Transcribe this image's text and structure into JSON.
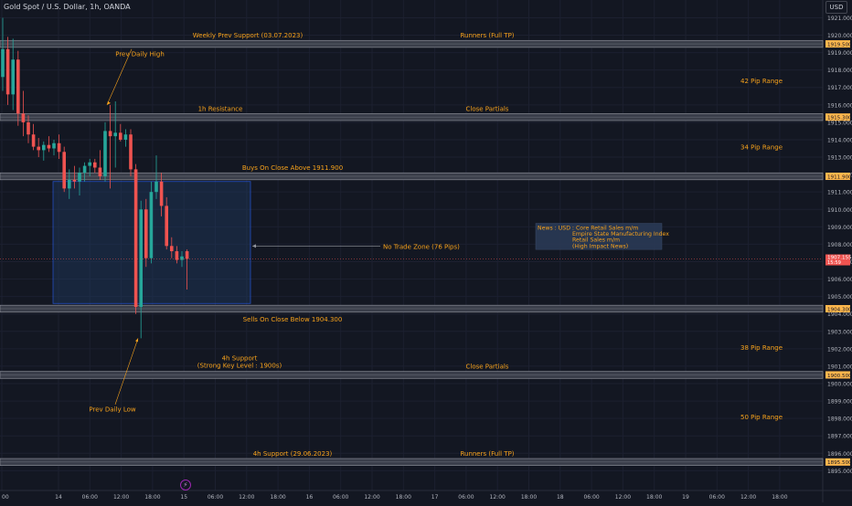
{
  "header": {
    "title": "Gold Spot / U.S. Dollar, 1h, OANDA",
    "currency": "USD"
  },
  "colors": {
    "background": "#131722",
    "bull": "#26a69a",
    "bear": "#ef5350",
    "label": "#f7a21b",
    "band": "#3a3e4a",
    "zone_fill": "#1e3a5f",
    "zone_border": "#2962ff",
    "grid": "#1c2030",
    "axis_text": "#b2b5be",
    "price_tag": "#ef5350"
  },
  "chart_data": {
    "type": "candlestick",
    "y_range": [
      1894.6,
      1921.6
    ],
    "y_ticks": [
      "1921.000",
      "1920.000",
      "1919.000",
      "1918.000",
      "1917.000",
      "1916.000",
      "1915.000",
      "1914.000",
      "1913.000",
      "1912.000",
      "1911.000",
      "1910.000",
      "1909.000",
      "1908.000",
      "1907.000",
      "1906.000",
      "1905.000",
      "1904.000",
      "1903.000",
      "1902.000",
      "1901.000",
      "1900.000",
      "1899.000",
      "1898.000",
      "1897.000",
      "1896.000",
      "1895.000"
    ],
    "x_ticks": [
      "00",
      "14",
      "06:00",
      "12:00",
      "18:00",
      "15",
      "06:00",
      "12:00",
      "18:00",
      "16",
      "06:00",
      "12:00",
      "18:00",
      "17",
      "06:00",
      "12:00",
      "18:00",
      "18",
      "06:00",
      "12:00",
      "18:00",
      "19",
      "06:00",
      "12:00",
      "18:00"
    ],
    "candles": [
      {
        "o": 1917.6,
        "h": 1921.0,
        "l": 1916.8,
        "c": 1919.2
      },
      {
        "o": 1919.2,
        "h": 1919.9,
        "l": 1916.0,
        "c": 1916.6
      },
      {
        "o": 1916.6,
        "h": 1919.8,
        "l": 1915.7,
        "c": 1918.6
      },
      {
        "o": 1918.6,
        "h": 1919.1,
        "l": 1914.8,
        "c": 1915.5
      },
      {
        "o": 1915.5,
        "h": 1916.8,
        "l": 1914.2,
        "c": 1915.0
      },
      {
        "o": 1915.0,
        "h": 1915.4,
        "l": 1913.8,
        "c": 1914.3
      },
      {
        "o": 1914.3,
        "h": 1914.9,
        "l": 1913.4,
        "c": 1913.6
      },
      {
        "o": 1913.6,
        "h": 1914.1,
        "l": 1913.0,
        "c": 1913.4
      },
      {
        "o": 1913.4,
        "h": 1913.9,
        "l": 1912.8,
        "c": 1913.7
      },
      {
        "o": 1913.7,
        "h": 1914.2,
        "l": 1913.3,
        "c": 1913.5
      },
      {
        "o": 1913.5,
        "h": 1914.0,
        "l": 1913.1,
        "c": 1913.8
      },
      {
        "o": 1913.8,
        "h": 1914.3,
        "l": 1912.9,
        "c": 1913.3
      },
      {
        "o": 1913.3,
        "h": 1913.6,
        "l": 1911.0,
        "c": 1911.2
      },
      {
        "o": 1911.2,
        "h": 1912.3,
        "l": 1910.6,
        "c": 1911.7
      },
      {
        "o": 1911.7,
        "h": 1912.5,
        "l": 1911.2,
        "c": 1911.6
      },
      {
        "o": 1911.6,
        "h": 1912.4,
        "l": 1910.8,
        "c": 1912.1
      },
      {
        "o": 1912.1,
        "h": 1912.7,
        "l": 1911.6,
        "c": 1912.5
      },
      {
        "o": 1912.5,
        "h": 1912.9,
        "l": 1911.9,
        "c": 1912.7
      },
      {
        "o": 1912.7,
        "h": 1912.9,
        "l": 1912.1,
        "c": 1912.4
      },
      {
        "o": 1912.4,
        "h": 1913.4,
        "l": 1911.7,
        "c": 1911.9
      },
      {
        "o": 1911.9,
        "h": 1915.0,
        "l": 1911.6,
        "c": 1914.5
      },
      {
        "o": 1914.5,
        "h": 1916.0,
        "l": 1911.2,
        "c": 1914.2
      },
      {
        "o": 1914.2,
        "h": 1916.2,
        "l": 1912.4,
        "c": 1914.4
      },
      {
        "o": 1914.4,
        "h": 1914.9,
        "l": 1913.9,
        "c": 1914.0
      },
      {
        "o": 1914.0,
        "h": 1914.6,
        "l": 1913.6,
        "c": 1914.3
      },
      {
        "o": 1914.3,
        "h": 1914.6,
        "l": 1911.9,
        "c": 1912.3
      },
      {
        "o": 1912.3,
        "h": 1912.6,
        "l": 1904.0,
        "c": 1904.4
      },
      {
        "o": 1904.4,
        "h": 1910.5,
        "l": 1902.6,
        "c": 1910.0
      },
      {
        "o": 1910.0,
        "h": 1910.6,
        "l": 1906.7,
        "c": 1907.2
      },
      {
        "o": 1907.2,
        "h": 1911.6,
        "l": 1906.9,
        "c": 1911.0
      },
      {
        "o": 1911.0,
        "h": 1913.1,
        "l": 1910.6,
        "c": 1911.6
      },
      {
        "o": 1911.6,
        "h": 1912.1,
        "l": 1909.6,
        "c": 1910.2
      },
      {
        "o": 1910.2,
        "h": 1910.7,
        "l": 1907.7,
        "c": 1907.9
      },
      {
        "o": 1907.9,
        "h": 1908.4,
        "l": 1907.2,
        "c": 1907.6
      },
      {
        "o": 1907.6,
        "h": 1907.9,
        "l": 1906.9,
        "c": 1907.1
      },
      {
        "o": 1907.1,
        "h": 1907.6,
        "l": 1906.7,
        "c": 1907.3
      },
      {
        "o": 1907.6,
        "h": 1907.7,
        "l": 1905.4,
        "c": 1907.16
      }
    ],
    "levels": [
      {
        "top": 1919.7,
        "bottom": 1919.3,
        "tag": "1919.500",
        "label": "Weekly Prev Support (03.07.2023)",
        "right_label": "Runners (Full TP)"
      },
      {
        "top": 1915.5,
        "bottom": 1915.1,
        "tag": "1915.300",
        "label": "1h Resistance",
        "right_label": "Close Partials"
      },
      {
        "top": 1912.1,
        "bottom": 1911.7,
        "tag": "1911.900",
        "label": "Buys On Close Above 1911.900",
        "right_label": ""
      },
      {
        "top": 1904.5,
        "bottom": 1904.1,
        "tag": "1904.300",
        "label": "Sells On Close Below 1904.300",
        "right_label": ""
      },
      {
        "top": 1900.7,
        "bottom": 1900.3,
        "tag": "1900.500",
        "label": "",
        "right_label": "Close Partials"
      },
      {
        "top": 1895.7,
        "bottom": 1895.3,
        "tag": "1895.500",
        "label": "4h Support (29.06.2023)",
        "right_label": "Runners (Full TP)"
      }
    ],
    "pip_ranges": [
      {
        "text": "42 Pip Range",
        "price": 1917.4
      },
      {
        "text": "34 Pip Range",
        "price": 1913.6
      },
      {
        "text": "38 Pip Range",
        "price": 1902.1
      },
      {
        "text": "50 Pip Range",
        "price": 1898.1
      }
    ],
    "support_4h_label": {
      "line1": "4h Support",
      "line2": "(Strong Key Level : 1900s)"
    },
    "no_trade_zone": {
      "top": 1911.6,
      "bottom": 1904.6,
      "label": "No Trade Zone (76 Pips)"
    },
    "annotations": {
      "prev_daily_high": "Prev Daily High",
      "prev_daily_low": "Prev Daily Low"
    },
    "news_box": {
      "lines": [
        "News : USD : Core Retail Sales m/m",
        "Empire State Manufacturing Index",
        "Retail Sales m/m",
        "(High Impact News)"
      ]
    },
    "last_price": {
      "value": "1907.155",
      "countdown": "15:59",
      "price": 1907.155
    }
  }
}
